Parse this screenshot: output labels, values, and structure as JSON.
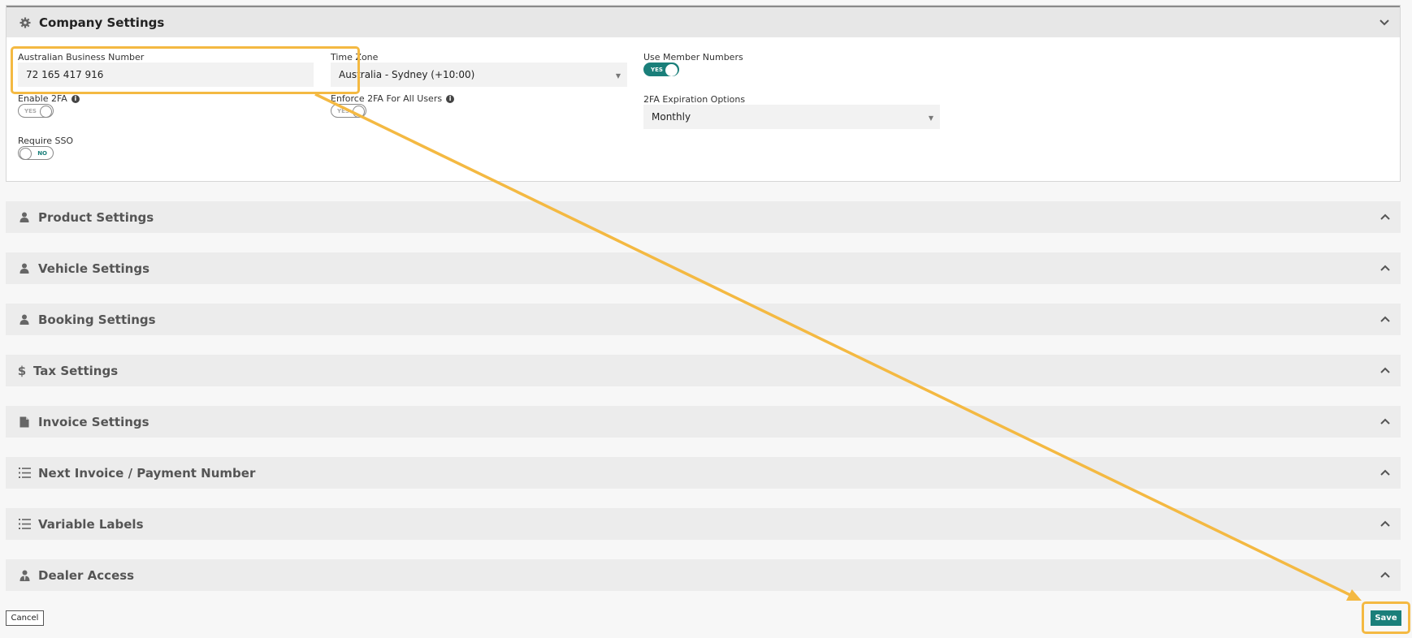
{
  "company": {
    "title": "Company Settings",
    "abn_label": "Australian Business Number",
    "abn_value": "72 165 417 916",
    "timezone_label": "Time Zone",
    "timezone_value": "Australia - Sydney (+10:00)",
    "member_numbers_label": "Use Member Numbers",
    "member_numbers_toggle": "YES",
    "enable_2fa_label": "Enable 2FA",
    "enable_2fa_toggle": "YES",
    "enforce_2fa_label": "Enforce 2FA For All Users",
    "enforce_2fa_toggle": "YES",
    "expiration_label": "2FA Expiration Options",
    "expiration_value": "Monthly",
    "require_sso_label": "Require SSO",
    "require_sso_toggle": "NO"
  },
  "sections": [
    {
      "title": "Product Settings",
      "icon": "user-icon"
    },
    {
      "title": "Vehicle Settings",
      "icon": "user-icon"
    },
    {
      "title": "Booking Settings",
      "icon": "user-icon"
    },
    {
      "title": "Tax Settings",
      "icon": "dollar-icon"
    },
    {
      "title": "Invoice Settings",
      "icon": "file-icon"
    },
    {
      "title": "Next Invoice / Payment Number",
      "icon": "list-icon"
    },
    {
      "title": "Variable Labels",
      "icon": "list-icon"
    },
    {
      "title": "Dealer Access",
      "icon": "user-tie-icon"
    }
  ],
  "footer": {
    "cancel_label": "Cancel",
    "save_label": "Save"
  },
  "colors": {
    "accent": "#1a7f7a",
    "highlight": "#f4b942"
  }
}
